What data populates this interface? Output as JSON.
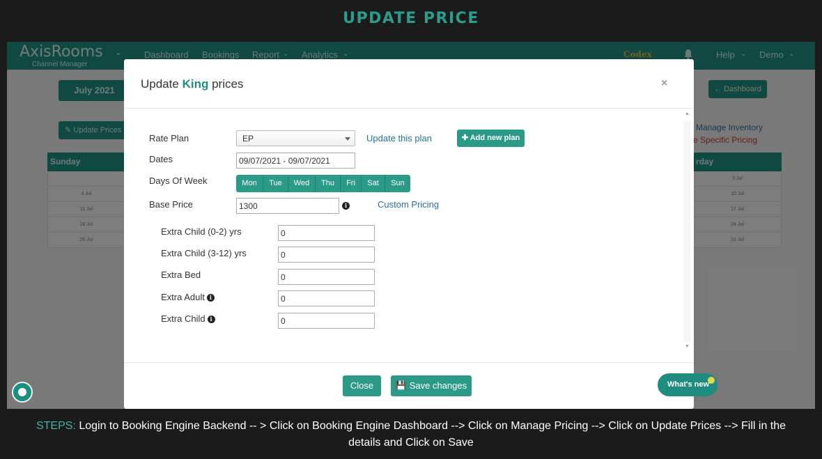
{
  "page_title": "UPDATE PRICE",
  "nav": {
    "brand": "AxisRooms",
    "brand_sub": "Channel Manager",
    "items": [
      "Dashboard",
      "Bookings",
      "Report",
      "Analytics"
    ],
    "codex": "Codex",
    "help": "Help",
    "user": "Demo"
  },
  "background": {
    "month_button": "July 2021",
    "update_prices_button": "Update Prices",
    "dashboard_button": "Dashboard",
    "manage_inventory": "Manage Inventory",
    "delete_pricing": "ete Specific Pricing",
    "col_left_header": "Sunday",
    "col_right_header": "rday",
    "left_dates": [
      "",
      "4 Jul",
      "11 Jul",
      "18 Jul",
      "25 Jul"
    ],
    "right_dates": [
      "3 Jul",
      "10 Jul",
      "17 Jul",
      "24 Jul",
      "31 Jul"
    ]
  },
  "modal": {
    "title_prefix": "Update",
    "room": "King",
    "title_suffix": "prices",
    "close_x": "×",
    "rate_plan_label": "Rate Plan",
    "rate_plan_value": "EP",
    "update_plan_link": "Update this plan",
    "add_plan_button": "Add new plan",
    "dates_label": "Dates",
    "dates_value": "09/07/2021 - 09/07/2021",
    "days_label": "Days Of Week",
    "days": [
      "Mon",
      "Tue",
      "Wed",
      "Thu",
      "Fri",
      "Sat",
      "Sun"
    ],
    "base_price_label": "Base Price",
    "base_price_value": "1300",
    "custom_pricing_link": "Custom Pricing",
    "extras": [
      {
        "label": "Extra Child (0-2) yrs",
        "value": "0",
        "info": false
      },
      {
        "label": "Extra Child (3-12) yrs",
        "value": "0",
        "info": false
      },
      {
        "label": "Extra Bed",
        "value": "0",
        "info": false
      },
      {
        "label": "Extra Adult",
        "value": "0",
        "info": true
      },
      {
        "label": "Extra Child",
        "value": "0",
        "info": true
      }
    ],
    "close_button": "Close",
    "save_button": "Save changes"
  },
  "whats_new": "What's new",
  "steps": {
    "tag": "STEPS:",
    "text": "Login to Booking Engine Backend -- > Click on Booking Engine Dashboard -->  Click on Manage Pricing --> Click on Update Prices --> Fill in the details and Click on Save"
  },
  "colors": {
    "accent": "#1e8c7e",
    "link": "#2a6f9b"
  }
}
